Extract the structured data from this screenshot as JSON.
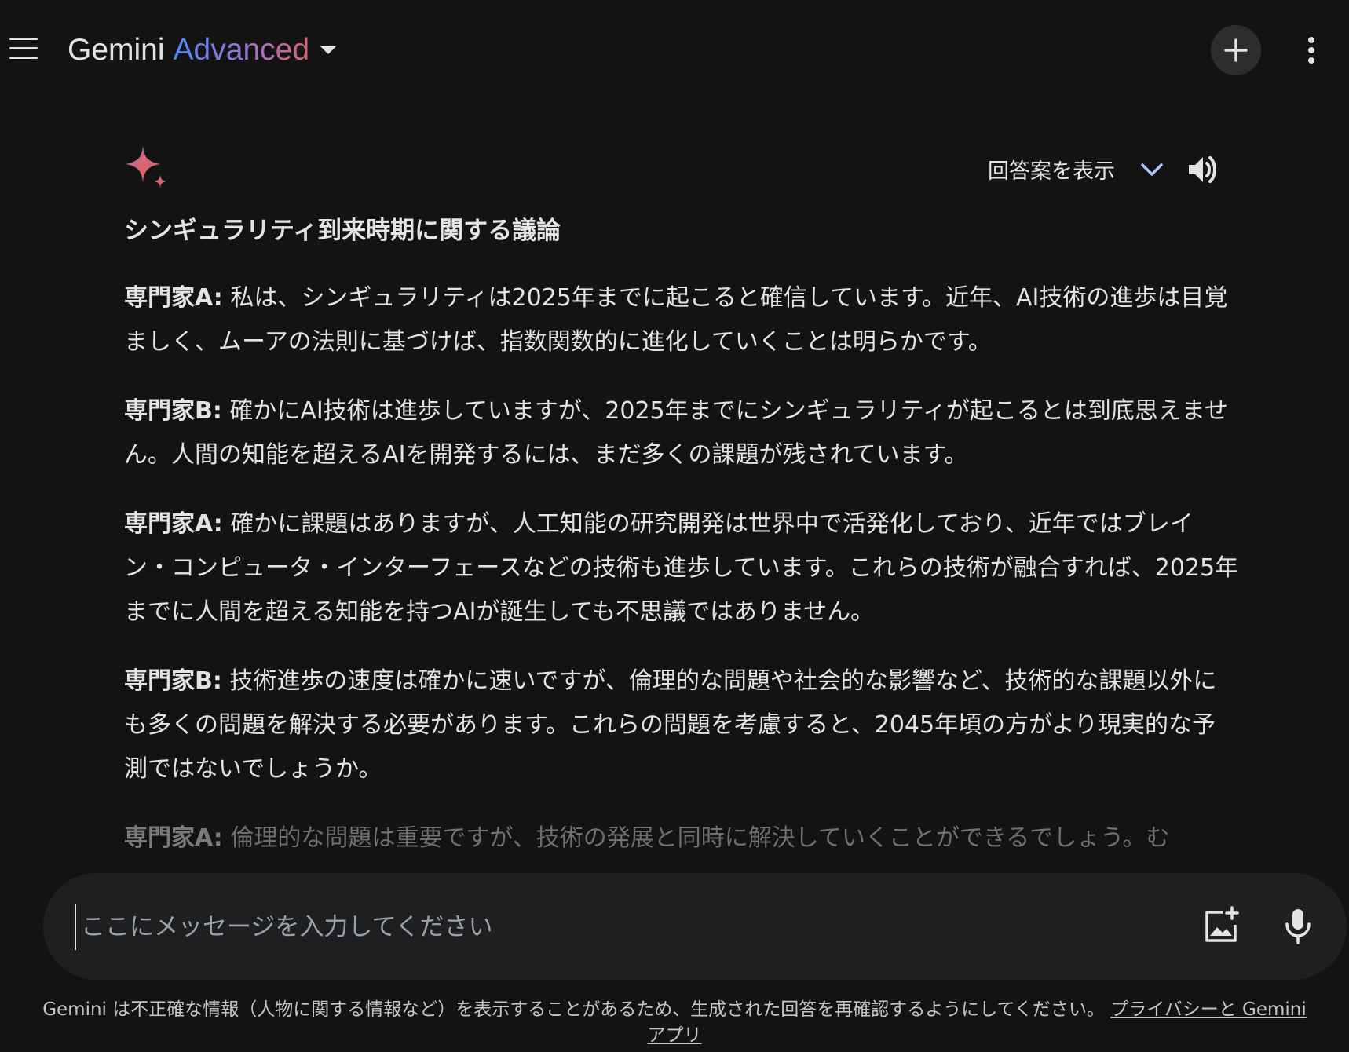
{
  "header": {
    "brand": "Gemini",
    "tier": "Advanced"
  },
  "response": {
    "show_drafts_label": "回答案を表示",
    "title": "シンギュラリティ到来時期に関する議論",
    "paragraphs": [
      {
        "speaker": "専門家A:",
        "text": " 私は、シンギュラリティは2025年までに起こると確信しています。近年、AI技術の進歩は目覚ましく、ムーアの法則に基づけば、指数関数的に進化していくことは明らかです。"
      },
      {
        "speaker": "専門家B:",
        "text": " 確かにAI技術は進歩していますが、2025年までにシンギュラリティが起こるとは到底思えません。人間の知能を超えるAIを開発するには、まだ多くの課題が残されています。"
      },
      {
        "speaker": "専門家A:",
        "text": " 確かに課題はありますが、人工知能の研究開発は世界中で活発化しており、近年ではブレイン・コンピュータ・インターフェースなどの技術も進歩しています。これらの技術が融合すれば、2025年までに人間を超える知能を持つAIが誕生しても不思議ではありません。"
      },
      {
        "speaker": "専門家B:",
        "text": " 技術進歩の速度は確かに速いですが、倫理的な問題や社会的な影響など、技術的な課題以外にも多くの問題を解決する必要があります。これらの問題を考慮すると、2045年頃の方がより現実的な予測ではないでしょうか。"
      },
      {
        "speaker": "専門家A:",
        "text": " 倫理的な問題は重要ですが、技術の発展と同時に解決していくことができるでしょう。む"
      }
    ]
  },
  "input": {
    "placeholder": "ここにメッセージを入力してください"
  },
  "footer": {
    "disclaimer": "Gemini は不正確な情報（人物に関する情報など）を表示することがあるため、生成された回答を再確認するようにしてください。",
    "privacy_link": "プライバシーと Gemini アプリ"
  },
  "icons": {
    "menu": "menu-icon",
    "new_chat": "plus-icon",
    "more": "more-vertical-icon",
    "logo": "sparkle-icon",
    "drafts": "chevron-down-icon",
    "speaker": "volume-icon",
    "image_upload": "image-add-icon",
    "mic": "mic-icon"
  },
  "colors": {
    "background": "#131314",
    "input_background": "#1e1f20",
    "accent_blue": "#4e86f8",
    "accent_purple": "#9b72cb",
    "accent_pink": "#d96570"
  }
}
